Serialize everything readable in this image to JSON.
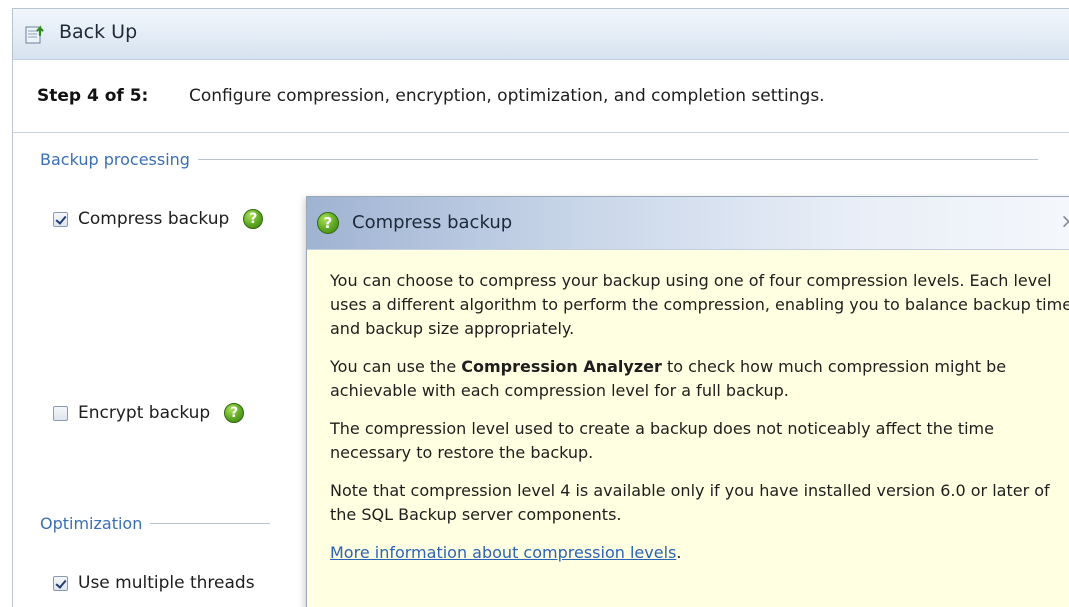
{
  "window": {
    "title": "Back Up"
  },
  "step": {
    "label": "Step 4 of 5:",
    "description": "Configure compression, encryption, optimization, and completion settings."
  },
  "sections": {
    "backup_processing": "Backup processing",
    "optimization": "Optimization"
  },
  "options": {
    "compress": {
      "label": "Compress backup",
      "checked": true
    },
    "encrypt": {
      "label": "Encrypt backup",
      "checked": false
    },
    "threads": {
      "label": "Use multiple threads",
      "checked": true
    }
  },
  "help_popup": {
    "title": "Compress backup",
    "close_glyph": "×",
    "para1": "You can choose to compress your backup using one of four compression levels. Each level uses a different algorithm to perform the compression, enabling you to balance backup time and backup size appropriately.",
    "para2_prefix": "You can use the ",
    "para2_bold": "Compression Analyzer",
    "para2_suffix": " to check how much compression might be achievable with each compression level for a full backup.",
    "para3": "The compression level used to create a backup does not noticeably affect the time necessary to restore the backup.",
    "para4": "Note that compression level 4 is available only if you have installed version 6.0 or later of the SQL Backup server components.",
    "link": "More information about compression levels",
    "link_suffix": "."
  },
  "icons": {
    "help": "help-icon",
    "app": "backup-wizard-icon"
  },
  "colors": {
    "section_heading": "#3a6fb4",
    "link": "#2c63b8",
    "popup_background": "#ffffe1",
    "help_icon": "#5ea722"
  }
}
